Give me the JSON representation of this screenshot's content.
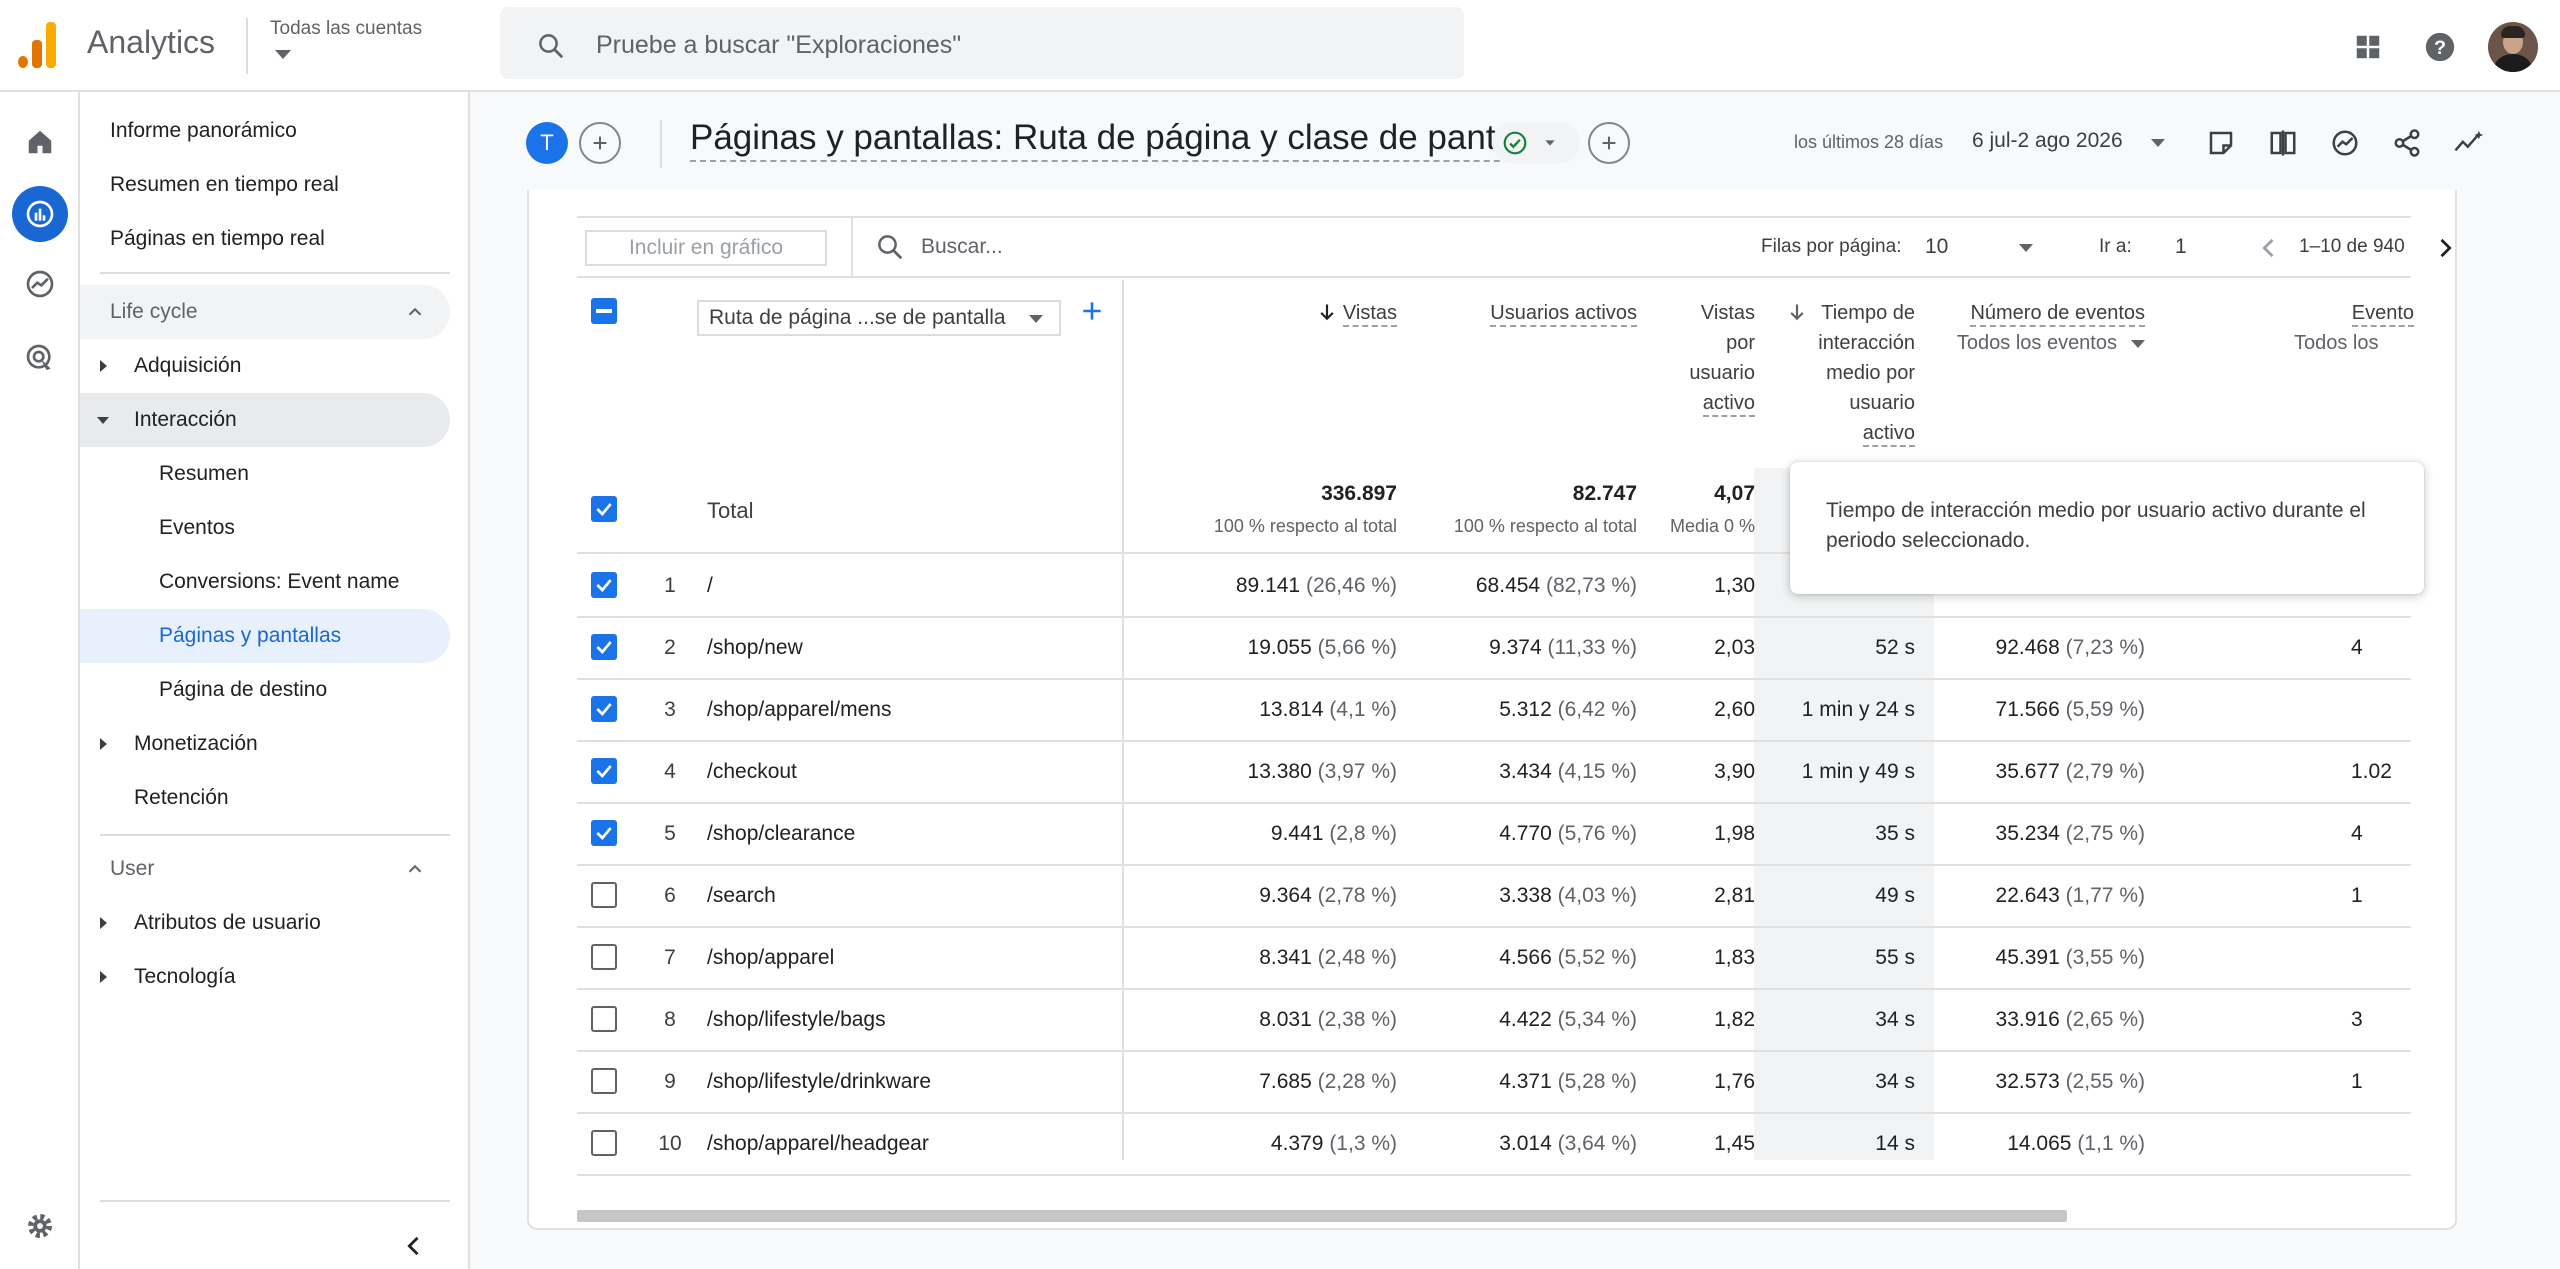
{
  "app": {
    "name": "Analytics",
    "account_label": "Todas las cuentas",
    "search_placeholder": "Pruebe a buscar \"Exploraciones\"",
    "logo_colors": [
      "#f9ab00",
      "#e37400",
      "#e37400"
    ]
  },
  "rail": {
    "icons": [
      "home-icon",
      "reports-icon",
      "explore-icon",
      "advertising-icon",
      "settings-icon"
    ],
    "active": "reports-icon",
    "accent": "#1967d2"
  },
  "nav": {
    "top_items": [
      "Informe panorámico",
      "Resumen en tiempo real",
      "Páginas en tiempo real"
    ],
    "lifecycle": {
      "label": "Life cycle",
      "adquisicion": "Adquisición",
      "interaccion": "Interacción",
      "sub": [
        "Resumen",
        "Eventos",
        "Conversions: Event name",
        "Páginas y pantallas",
        "Página de destino"
      ],
      "selected": "Páginas y pantallas",
      "monetizacion": "Monetización",
      "retencion": "Retención"
    },
    "user": {
      "label": "User",
      "atributos": "Atributos de usuario",
      "tecnologia": "Tecnología"
    }
  },
  "header": {
    "avatar_letter": "T",
    "title": "Páginas y pantallas: Ruta de página y clase de pantalla",
    "date_label": "los últimos 28 días",
    "date_range": "6 jul-2 ago 2026"
  },
  "toolbar": {
    "include_chart": "Incluir en gráfico",
    "search_placeholder": "Buscar...",
    "rows_label": "Filas por página:",
    "rows_value": "10",
    "goto_label": "Ir a:",
    "goto_value": "1",
    "page_range": "1–10 de 940"
  },
  "table": {
    "dimension_chip": "Ruta de página ...se de pantalla",
    "columns": {
      "vistas": "Vistas",
      "usuarios": "Usuarios activos",
      "vistas_por": [
        "Vistas",
        "por",
        "usuario",
        "activo"
      ],
      "tiempo": [
        "Tiempo de",
        "interacción",
        "medio por",
        "usuario",
        "activo"
      ],
      "eventos": "Número de eventos",
      "eventos_sub": "Todos los eventos",
      "eventos2": "Evento",
      "eventos2_sub": "Todos los"
    },
    "total": {
      "label": "Total",
      "vistas": "336.897",
      "vistas_sub": "100 % respecto al total",
      "usuarios": "82.747",
      "usuarios_sub": "100 % respecto al total",
      "vpu": "4,07",
      "vpu_sub": "Media 0 %"
    },
    "rows": [
      {
        "n": "1",
        "path": "/",
        "vistas": "89.141",
        "vistas_pct": "(26,46 %)",
        "usuarios": "68.454",
        "usuarios_pct": "(82,73 %)",
        "vpu": "1,30",
        "tiempo": "",
        "eventos": "",
        "eventos_pct": "",
        "ev2": "",
        "checked": true
      },
      {
        "n": "2",
        "path": "/shop/new",
        "vistas": "19.055",
        "vistas_pct": "(5,66 %)",
        "usuarios": "9.374",
        "usuarios_pct": "(11,33 %)",
        "vpu": "2,03",
        "tiempo": "52 s",
        "eventos": "92.468",
        "eventos_pct": "(7,23 %)",
        "ev2": "4",
        "checked": true
      },
      {
        "n": "3",
        "path": "/shop/apparel/mens",
        "vistas": "13.814",
        "vistas_pct": "(4,1 %)",
        "usuarios": "5.312",
        "usuarios_pct": "(6,42 %)",
        "vpu": "2,60",
        "tiempo": "1 min y 24 s",
        "eventos": "71.566",
        "eventos_pct": "(5,59 %)",
        "ev2": "",
        "checked": true
      },
      {
        "n": "4",
        "path": "/checkout",
        "vistas": "13.380",
        "vistas_pct": "(3,97 %)",
        "usuarios": "3.434",
        "usuarios_pct": "(4,15 %)",
        "vpu": "3,90",
        "tiempo": "1 min y 49 s",
        "eventos": "35.677",
        "eventos_pct": "(2,79 %)",
        "ev2": "1.02",
        "checked": true
      },
      {
        "n": "5",
        "path": "/shop/clearance",
        "vistas": "9.441",
        "vistas_pct": "(2,8 %)",
        "usuarios": "4.770",
        "usuarios_pct": "(5,76 %)",
        "vpu": "1,98",
        "tiempo": "35 s",
        "eventos": "35.234",
        "eventos_pct": "(2,75 %)",
        "ev2": "4",
        "checked": true
      },
      {
        "n": "6",
        "path": "/search",
        "vistas": "9.364",
        "vistas_pct": "(2,78 %)",
        "usuarios": "3.338",
        "usuarios_pct": "(4,03 %)",
        "vpu": "2,81",
        "tiempo": "49 s",
        "eventos": "22.643",
        "eventos_pct": "(1,77 %)",
        "ev2": "1",
        "checked": false
      },
      {
        "n": "7",
        "path": "/shop/apparel",
        "vistas": "8.341",
        "vistas_pct": "(2,48 %)",
        "usuarios": "4.566",
        "usuarios_pct": "(5,52 %)",
        "vpu": "1,83",
        "tiempo": "55 s",
        "eventos": "45.391",
        "eventos_pct": "(3,55 %)",
        "ev2": "",
        "checked": false
      },
      {
        "n": "8",
        "path": "/shop/lifestyle/bags",
        "vistas": "8.031",
        "vistas_pct": "(2,38 %)",
        "usuarios": "4.422",
        "usuarios_pct": "(5,34 %)",
        "vpu": "1,82",
        "tiempo": "34 s",
        "eventos": "33.916",
        "eventos_pct": "(2,65 %)",
        "ev2": "3",
        "checked": false
      },
      {
        "n": "9",
        "path": "/shop/lifestyle/drinkware",
        "vistas": "7.685",
        "vistas_pct": "(2,28 %)",
        "usuarios": "4.371",
        "usuarios_pct": "(5,28 %)",
        "vpu": "1,76",
        "tiempo": "34 s",
        "eventos": "32.573",
        "eventos_pct": "(2,55 %)",
        "ev2": "1",
        "checked": false
      },
      {
        "n": "10",
        "path": "/shop/apparel/headgear",
        "vistas": "4.379",
        "vistas_pct": "(1,3 %)",
        "usuarios": "3.014",
        "usuarios_pct": "(3,64 %)",
        "vpu": "1,45",
        "tiempo": "14 s",
        "eventos": "14.065",
        "eventos_pct": "(1,1 %)",
        "ev2": "",
        "checked": false
      }
    ]
  },
  "tooltip": {
    "text": "Tiempo de interacción medio por usuario activo durante el periodo seleccionado."
  }
}
